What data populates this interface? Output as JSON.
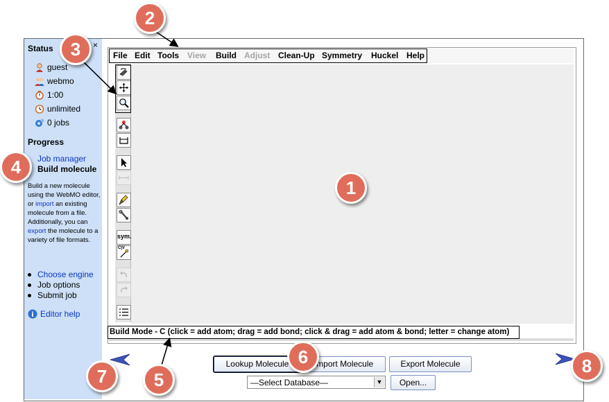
{
  "sidebar": {
    "status_title": "Status",
    "close_glyph": "×",
    "status_rows": [
      {
        "icon": "user-icon",
        "text": "guest"
      },
      {
        "icon": "users-icon",
        "text": "webmo"
      },
      {
        "icon": "timer-icon",
        "text": "1:00"
      },
      {
        "icon": "clock-icon",
        "text": "unlimited"
      },
      {
        "icon": "jobs-icon",
        "text": "0 jobs"
      }
    ],
    "progress_title": "Progress",
    "job_manager_link": "Job manager",
    "current_step": "Build molecule",
    "description": {
      "p1": "Build a new molecule using the WebMO editor, or ",
      "import_link": "import",
      "p2": " an existing molecule from a file. Additionally, you can ",
      "export_link": "export",
      "p3": " the molecule to a variety of file formats."
    },
    "steps": [
      "Choose engine",
      "Job options",
      "Submit job"
    ],
    "editor_help": "Editor help"
  },
  "menu": [
    "File",
    "Edit",
    "Tools",
    "View",
    "Build",
    "Adjust",
    "Clean-Up",
    "Symmetry",
    "Huckel",
    "Help"
  ],
  "menu_disabled": [
    "View",
    "Adjust"
  ],
  "toolbar": {
    "sym_label": "sym.",
    "csv_label": "C|V"
  },
  "status_text": "Build Mode - C (click = add atom; drag = add bond; click & drag = add atom & bond; letter = change atom)",
  "buttons": {
    "lookup": "Lookup Molecule",
    "import": "Import Molecule",
    "export": "Export Molecule",
    "open": "Open..."
  },
  "database_select": "—Select Database—",
  "callouts": [
    "1",
    "2",
    "3",
    "4",
    "5",
    "6",
    "7",
    "8"
  ],
  "colors": {
    "sidebar_bg": "#cde0f7",
    "callout": "#e06d5b",
    "link": "#0b35c2",
    "nav_arrow": "#3d52b8"
  }
}
